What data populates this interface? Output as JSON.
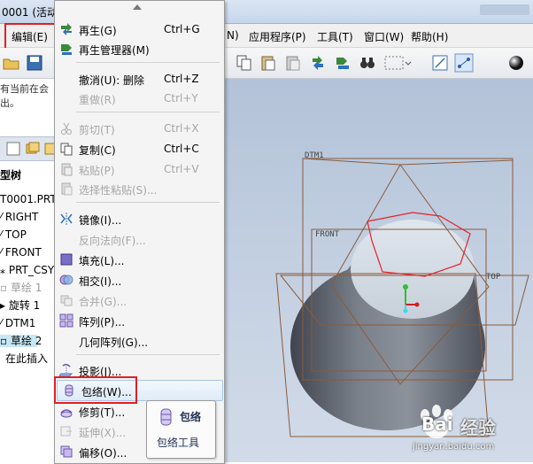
{
  "titlebar": {
    "title": "0001 (活动"
  },
  "menubar": {
    "items": [
      {
        "label": "编辑(E)"
      },
      {
        "label": "N)"
      },
      {
        "label": "应用程序(P)"
      },
      {
        "label": "工具(T)"
      },
      {
        "label": "窗口(W)"
      },
      {
        "label": "帮助(H)"
      }
    ]
  },
  "left_panel": {
    "message_line1": "有当前在会",
    "message_line2": "出。",
    "tree_title": "型树",
    "tree_items": [
      {
        "label": "T0001.PRT"
      },
      {
        "label": "RIGHT"
      },
      {
        "label": "TOP"
      },
      {
        "label": "FRONT"
      },
      {
        "label": "PRT_CSYS"
      },
      {
        "label": "草绘 1"
      },
      {
        "label": "旋转 1"
      },
      {
        "label": "DTM1"
      },
      {
        "label": "草绘 2"
      },
      {
        "label": "在此插入"
      }
    ]
  },
  "edit_menu": {
    "items": [
      {
        "label": "再生(G)",
        "shortcut": "Ctrl+G",
        "icon": "regenerate-icon"
      },
      {
        "label": "再生管理器(M)",
        "icon": "regen-manager-icon"
      },
      {
        "label": "撤消(U): 删除",
        "shortcut": "Ctrl+Z",
        "icon": "undo-icon"
      },
      {
        "label": "重做(R)",
        "shortcut": "Ctrl+Y",
        "icon": "redo-icon"
      },
      {
        "label": "剪切(T)",
        "shortcut": "Ctrl+X",
        "icon": "cut-icon"
      },
      {
        "label": "复制(C)",
        "shortcut": "Ctrl+C",
        "icon": "copy-icon"
      },
      {
        "label": "粘贴(P)",
        "shortcut": "Ctrl+V",
        "icon": "paste-icon"
      },
      {
        "label": "选择性粘贴(S)...",
        "icon": "paste-special-icon"
      },
      {
        "label": "镜像(I)...",
        "icon": "mirror-icon"
      },
      {
        "label": "反向法向(F)...",
        "icon": "flip-normal-icon"
      },
      {
        "label": "填充(L)...",
        "icon": "fill-icon"
      },
      {
        "label": "相交(I)...",
        "icon": "intersect-icon"
      },
      {
        "label": "合并(G)...",
        "icon": "merge-icon"
      },
      {
        "label": "阵列(P)...",
        "icon": "pattern-icon"
      },
      {
        "label": "几何阵列(G)...",
        "icon": "geometry-pattern-icon"
      },
      {
        "label": "投影(J)...",
        "icon": "project-icon"
      },
      {
        "label": "包络(W)...",
        "icon": "wrap-icon"
      },
      {
        "label": "修剪(T)...",
        "icon": "trim-icon"
      },
      {
        "label": "延伸(X)...",
        "icon": "extend-icon"
      },
      {
        "label": "偏移(O)...",
        "icon": "offset-icon"
      }
    ]
  },
  "tooltip": {
    "title": "包络",
    "description": "包络工具"
  },
  "viewport": {
    "datum_labels": {
      "dtm1": "DTM1",
      "front": "FRONT",
      "top": "TOP"
    }
  },
  "watermark": {
    "brand": "Bai",
    "suffix": "经验",
    "url": "jingyan.baidu.com"
  },
  "colors": {
    "highlight_box": "#e02020",
    "sketch_line": "#e8202a",
    "plane_line": "#8a5a3a"
  }
}
